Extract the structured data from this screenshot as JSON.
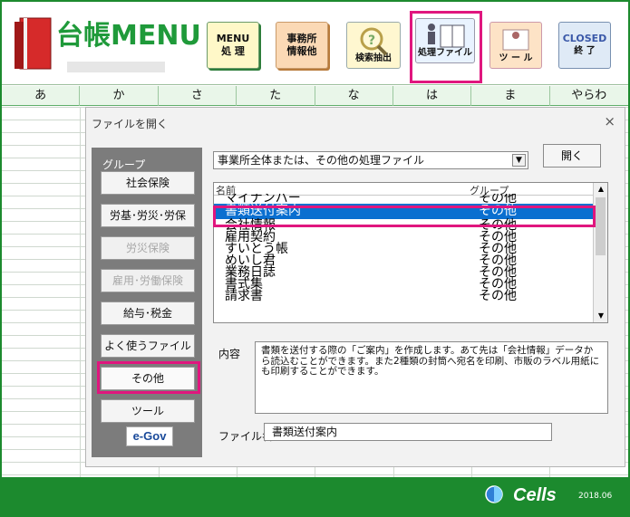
{
  "app": {
    "title": "台帳MENU",
    "menu_btn": "MENU\n処 理",
    "office_btn": "事務所\n情報他",
    "search_btn": "検索抽出",
    "proc_btn": "処理ファイル",
    "tool_btn": "ツ ー ル",
    "closed_top": "CLOSED",
    "closed_btn": "終 了"
  },
  "tabs": [
    "あ",
    "か",
    "さ",
    "た",
    "な",
    "は",
    "ま",
    "やらわ"
  ],
  "dialog": {
    "title": "ファイルを開く",
    "close": "×",
    "group_label": "グループ",
    "groups": [
      {
        "label": "社会保険",
        "state": "normal"
      },
      {
        "label": "労基･労災･労保",
        "state": "normal"
      },
      {
        "label": "労災保険",
        "state": "disabled"
      },
      {
        "label": "雇用･労働保険",
        "state": "disabled"
      },
      {
        "label": "給与･税金",
        "state": "normal"
      },
      {
        "label": "よく使うファイル",
        "state": "normal"
      },
      {
        "label": "その他",
        "state": "selected"
      },
      {
        "label": "ツール",
        "state": "normal"
      }
    ],
    "egov": "e-Gov",
    "select_value": "事業所全体または、その他の処理ファイル",
    "open_button": "開く",
    "col_name": "名前",
    "col_group": "グループ",
    "files": [
      {
        "name": "マイナンバー",
        "group": "その他"
      },
      {
        "name": "書類送付案内",
        "group": "その他",
        "selected": true
      },
      {
        "name": "会社情報",
        "group": "その他"
      },
      {
        "name": "雇用契約",
        "group": "その他"
      },
      {
        "name": "すいとう帳",
        "group": "その他"
      },
      {
        "name": "めいし君",
        "group": "その他"
      },
      {
        "name": "業務日誌",
        "group": "その他"
      },
      {
        "name": "書式集",
        "group": "その他"
      },
      {
        "name": "請求書",
        "group": "その他"
      }
    ],
    "content_label": "内容",
    "content_text": "書類を送付する際の「ご案内」を作成します。あて先は「会社情報」データから読込むことができます。また2種類の封筒へ宛名を印刷、市販のラベル用紙にも印刷することができます。",
    "filename_label": "ファイル名",
    "filename_value": "書類送付案内"
  },
  "footer": {
    "brand": "Cells",
    "version": "2018.06"
  },
  "colors": {
    "brand_green": "#1c8a2e",
    "highlight": "#e0167e",
    "selection": "#0a6fd0"
  }
}
